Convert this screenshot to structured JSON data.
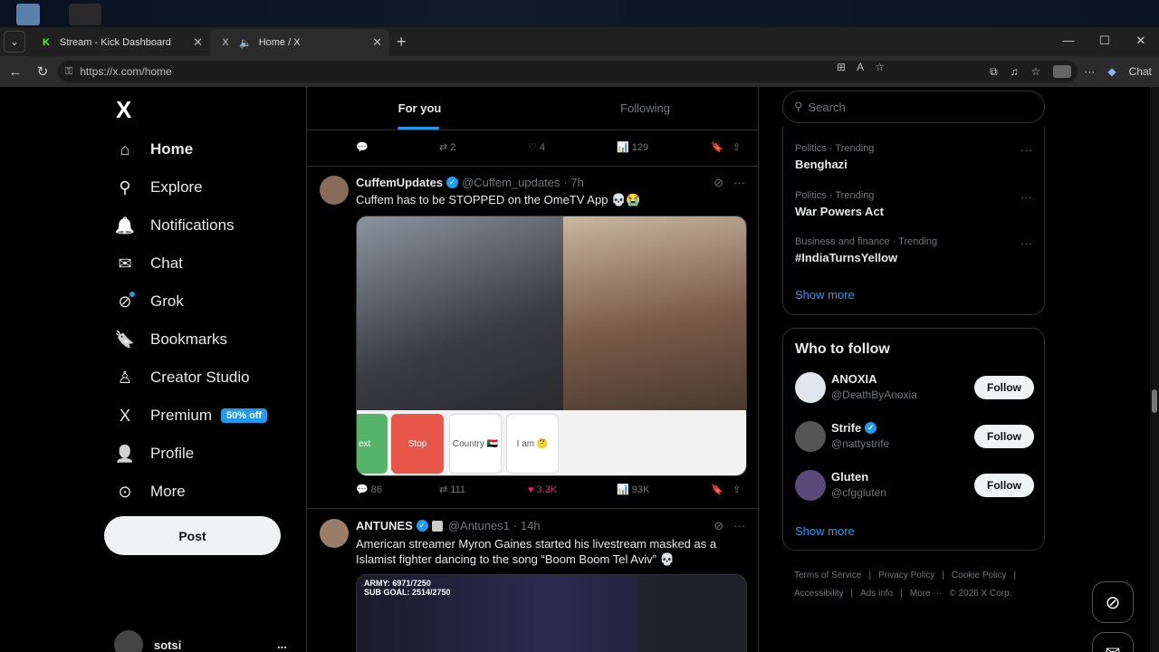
{
  "browser": {
    "tabs": [
      {
        "label": "Stream - Kick Dashboard",
        "favicon": "K"
      },
      {
        "label": "Home / X",
        "favicon": "X"
      }
    ],
    "url": "https://x.com/home",
    "chat_label": "Chat"
  },
  "sidebar": {
    "logo": "X",
    "items": [
      {
        "label": "Home",
        "icon": "home-icon",
        "glyph": "⌂"
      },
      {
        "label": "Explore",
        "icon": "search-icon",
        "glyph": "⚲"
      },
      {
        "label": "Notifications",
        "icon": "bell-icon",
        "glyph": "🔔"
      },
      {
        "label": "Chat",
        "icon": "mail-icon",
        "glyph": "✉"
      },
      {
        "label": "Grok",
        "icon": "grok-icon",
        "glyph": "⊘"
      },
      {
        "label": "Bookmarks",
        "icon": "bookmark-icon",
        "glyph": "🔖"
      },
      {
        "label": "Creator Studio",
        "icon": "creator-icon",
        "glyph": "♙"
      },
      {
        "label": "Premium",
        "icon": "x-premium-icon",
        "glyph": "X",
        "badge": "50% off"
      },
      {
        "label": "Profile",
        "icon": "person-icon",
        "glyph": "👤"
      },
      {
        "label": "More",
        "icon": "more-circle-icon",
        "glyph": "⊙"
      }
    ],
    "post_label": "Post",
    "account_name": "sotsi",
    "account_more": "..."
  },
  "feed": {
    "tabs": [
      "For you",
      "Following"
    ],
    "top_actions": {
      "replies": "",
      "reposts": "2",
      "likes": "4",
      "views": "129"
    },
    "tweets": [
      {
        "name": "CuffemUpdates",
        "handle": "@Cuffem_updates",
        "time": "· 7h",
        "text": "Cuffem has to be STOPPED on the OmeTV App 💀😭",
        "media_buttons": [
          "ext",
          "Stop",
          "Country 🇸🇩",
          "I am 🤔"
        ],
        "actions": {
          "replies": "86",
          "reposts": "111",
          "likes": "3.3K",
          "views": "93K"
        }
      },
      {
        "name": "ANTUNES",
        "handle": "@Antunes1",
        "time": "· 14h",
        "text": "American streamer Myron Gaines started his livestream masked as a Islamist fighter dancing to the song “Boom Boom Tel Aviv” 💀",
        "overlay": "ARMY: 6971/7250\nSUB GOAL: 2514/2750"
      }
    ]
  },
  "right": {
    "search_placeholder": "Search",
    "trends": [
      {
        "category": "Politics · Trending",
        "name": "Benghazi"
      },
      {
        "category": "Politics · Trending",
        "name": "War Powers Act"
      },
      {
        "category": "Business and finance · Trending",
        "name": "#IndiaTurnsYellow"
      }
    ],
    "show_more": "Show more",
    "who_to_follow_title": "Who to follow",
    "follow": [
      {
        "name": "ANOXIA",
        "handle": "@DeathByAnoxia",
        "verified": false,
        "btn": "Follow"
      },
      {
        "name": "Strife",
        "handle": "@nattystrife",
        "verified": true,
        "btn": "Follow"
      },
      {
        "name": "Gluten",
        "handle": "@cfggluten",
        "verified": false,
        "btn": "Follow"
      }
    ],
    "footer": [
      "Terms of Service",
      "|",
      "Privacy Policy",
      "|",
      "Cookie Policy",
      "|",
      "Accessibility",
      "|",
      "Ads info",
      "|",
      "More ···",
      "© 2026 X Corp."
    ]
  },
  "colors": {
    "accent": "#1d9bf0",
    "like": "#f91880",
    "background": "#000000"
  }
}
